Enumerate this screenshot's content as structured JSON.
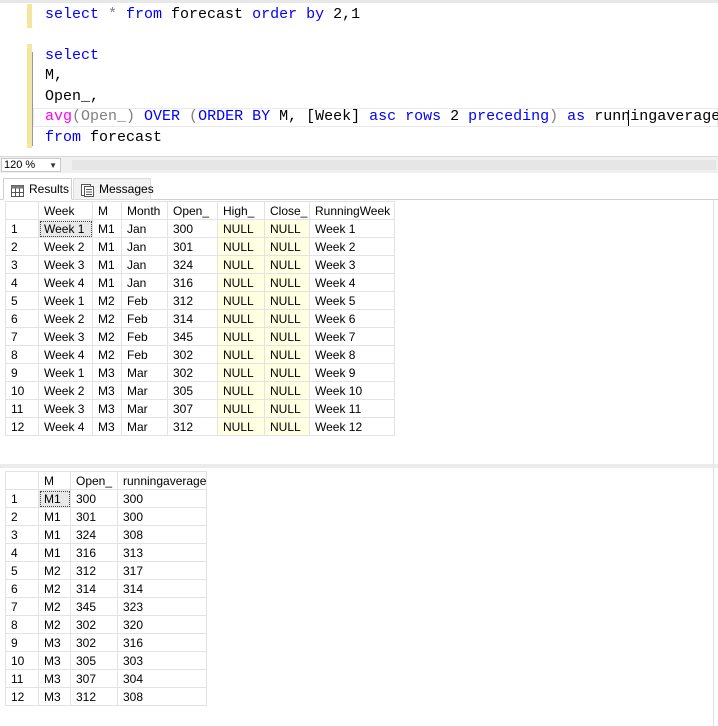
{
  "editor": {
    "line1": {
      "kw1": "select",
      "star": " * ",
      "kw2": "from",
      "ident": " forecast ",
      "kw3": "order by",
      "rest": " 2,1"
    },
    "line3": {
      "kw": "select"
    },
    "line4": {
      "text": "M,"
    },
    "line5": {
      "text": "Open_,"
    },
    "line6": {
      "fn": "avg",
      "p1": "(Open_) ",
      "kw1": "OVER",
      "p2": " (",
      "kw2": "ORDER BY",
      "p3": " M, [Week] ",
      "kw3": "asc rows",
      "p4": " 2 ",
      "kw4": "preceding",
      "p5": ") ",
      "kw5": "as",
      "p6": " runningaverage"
    },
    "line7": {
      "kw": "from",
      "ident": " forecast"
    }
  },
  "zoom": {
    "value": "120 %"
  },
  "tabs": {
    "results": "Results",
    "messages": "Messages"
  },
  "grid1": {
    "columns": [
      "Week",
      "M",
      "Month",
      "Open_",
      "High_",
      "Close_",
      "RunningWeek"
    ],
    "rows": [
      [
        "1",
        "Week 1",
        "M1",
        "Jan",
        "300",
        "NULL",
        "NULL",
        "Week 1"
      ],
      [
        "2",
        "Week 2",
        "M1",
        "Jan",
        "301",
        "NULL",
        "NULL",
        "Week 2"
      ],
      [
        "3",
        "Week 3",
        "M1",
        "Jan",
        "324",
        "NULL",
        "NULL",
        "Week 3"
      ],
      [
        "4",
        "Week 4",
        "M1",
        "Jan",
        "316",
        "NULL",
        "NULL",
        "Week 4"
      ],
      [
        "5",
        "Week 1",
        "M2",
        "Feb",
        "312",
        "NULL",
        "NULL",
        "Week 5"
      ],
      [
        "6",
        "Week 2",
        "M2",
        "Feb",
        "314",
        "NULL",
        "NULL",
        "Week 6"
      ],
      [
        "7",
        "Week 3",
        "M2",
        "Feb",
        "345",
        "NULL",
        "NULL",
        "Week 7"
      ],
      [
        "8",
        "Week 4",
        "M2",
        "Feb",
        "302",
        "NULL",
        "NULL",
        "Week 8"
      ],
      [
        "9",
        "Week 1",
        "M3",
        "Mar",
        "302",
        "NULL",
        "NULL",
        "Week 9"
      ],
      [
        "10",
        "Week 2",
        "M3",
        "Mar",
        "305",
        "NULL",
        "NULL",
        "Week 10"
      ],
      [
        "11",
        "Week 3",
        "M3",
        "Mar",
        "307",
        "NULL",
        "NULL",
        "Week 11"
      ],
      [
        "12",
        "Week 4",
        "M3",
        "Mar",
        "312",
        "NULL",
        "NULL",
        "Week 12"
      ]
    ]
  },
  "grid2": {
    "columns": [
      "M",
      "Open_",
      "runningaverage"
    ],
    "rows": [
      [
        "1",
        "M1",
        "300",
        "300"
      ],
      [
        "2",
        "M1",
        "301",
        "300"
      ],
      [
        "3",
        "M1",
        "324",
        "308"
      ],
      [
        "4",
        "M1",
        "316",
        "313"
      ],
      [
        "5",
        "M2",
        "312",
        "317"
      ],
      [
        "6",
        "M2",
        "314",
        "314"
      ],
      [
        "7",
        "M2",
        "345",
        "323"
      ],
      [
        "8",
        "M2",
        "302",
        "320"
      ],
      [
        "9",
        "M3",
        "302",
        "316"
      ],
      [
        "10",
        "M3",
        "305",
        "303"
      ],
      [
        "11",
        "M3",
        "307",
        "304"
      ],
      [
        "12",
        "M3",
        "312",
        "308"
      ]
    ]
  },
  "colors": {
    "keyword": "#0000ff",
    "function": "#ff00ff",
    "null_cell": "#ffffe1",
    "margin_mark": "#f2e7a0"
  },
  "icons": {
    "results_tab": "grid-icon",
    "messages_tab": "messages-icon"
  }
}
